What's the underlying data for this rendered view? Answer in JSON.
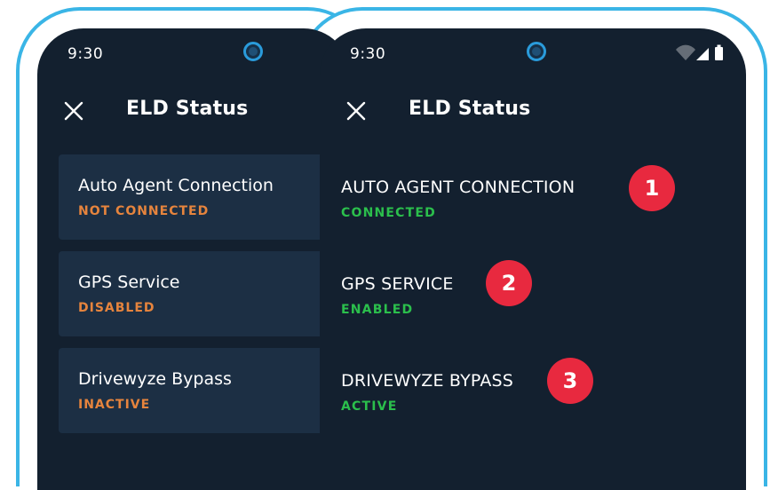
{
  "back_screen": {
    "time": "9:30",
    "title": "ELD Status",
    "items": [
      {
        "label": "Auto Agent Connection",
        "status": "NOT CONNECTED"
      },
      {
        "label": "GPS Service",
        "status": "DISABLED"
      },
      {
        "label": "Drivewyze Bypass",
        "status": "INACTIVE"
      }
    ]
  },
  "front_screen": {
    "time": "9:30",
    "title": "ELD Status",
    "items": [
      {
        "label": "AUTO AGENT CONNECTION",
        "status": "CONNECTED",
        "marker": "1"
      },
      {
        "label": "GPS SERVICE",
        "status": "ENABLED",
        "marker": "2"
      },
      {
        "label": "DRIVEWYZE BYPASS",
        "status": "ACTIVE",
        "marker": "3"
      }
    ]
  },
  "colors": {
    "outline": "#3ab5e6",
    "screen_bg": "#13202f",
    "card_bg": "#1c2f44",
    "inactive_status": "#e6843d",
    "active_status": "#2bbf4c",
    "marker": "#e8293f"
  },
  "icons": {
    "close": "close-icon",
    "camera": "camera-icon",
    "wifi": "wifi-icon",
    "signal": "signal-icon",
    "battery": "battery-icon"
  }
}
